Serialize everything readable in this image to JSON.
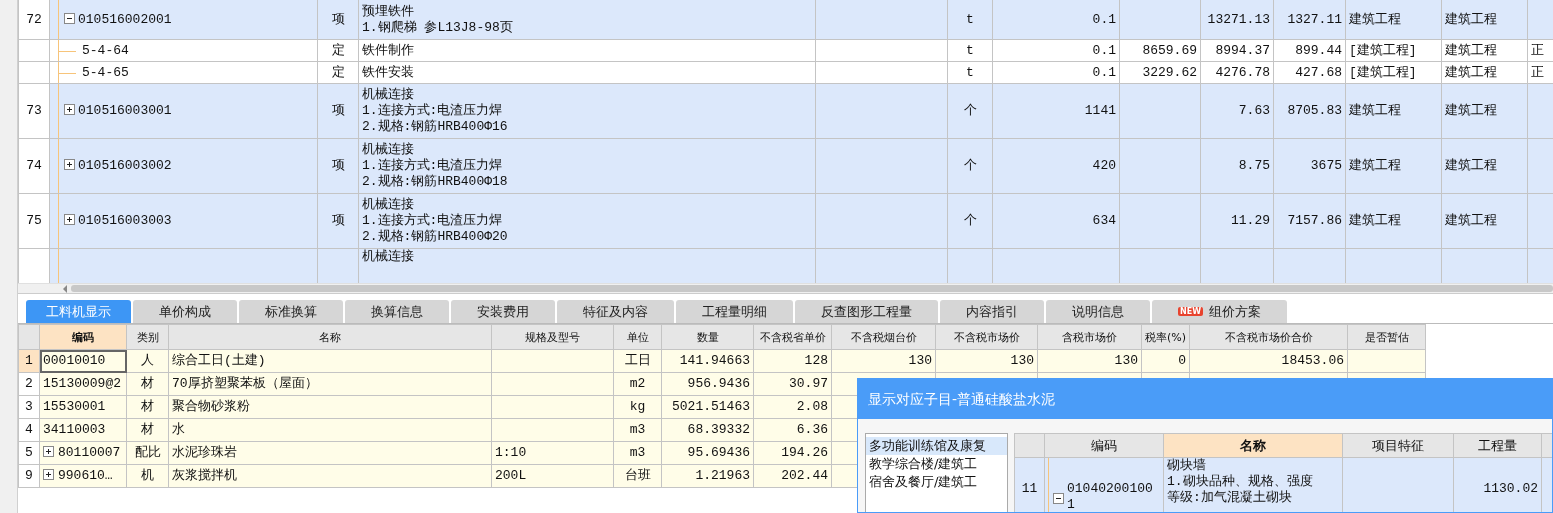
{
  "top_table": {
    "rows": [
      {
        "kind": "item",
        "column_1": "72",
        "expanded": true,
        "column_2": "010516002001",
        "column_3": "项",
        "column_4": [
          "预埋铁件",
          "1.钢爬梯 参L13J8-98页"
        ],
        "column_6": "t",
        "column_7": "0.1",
        "column_9": "13271.13",
        "column_10": "1327.11",
        "column_11": "建筑工程",
        "column_12": "建筑工程"
      },
      {
        "kind": "sub",
        "column_2": "5-4-64",
        "column_3": "定",
        "column_4": [
          "铁件制作"
        ],
        "column_6": "t",
        "column_7": "0.1",
        "column_8": "8659.69",
        "column_9": "8994.37",
        "column_10": "899.44",
        "column_11": "[建筑工程]",
        "column_12": "建筑工程",
        "column_13": "正"
      },
      {
        "kind": "sub",
        "column_2": "5-4-65",
        "column_3": "定",
        "column_4": [
          "铁件安装"
        ],
        "column_6": "t",
        "column_7": "0.1",
        "column_8": "3229.62",
        "column_9": "4276.78",
        "column_10": "427.68",
        "column_11": "[建筑工程]",
        "column_12": "建筑工程",
        "column_13": "正"
      },
      {
        "kind": "item",
        "column_1": "73",
        "expanded": false,
        "column_2": "010516003001",
        "column_3": "项",
        "column_4": [
          "机械连接",
          "1.连接方式:电渣压力焊",
          "2.规格:钢筋HRB400Φ16"
        ],
        "column_6": "个",
        "column_7": "1141",
        "column_9": "7.63",
        "column_10": "8705.83",
        "column_11": "建筑工程",
        "column_12": "建筑工程"
      },
      {
        "kind": "item",
        "column_1": "74",
        "expanded": false,
        "column_2": "010516003002",
        "column_3": "项",
        "column_4": [
          "机械连接",
          "1.连接方式:电渣压力焊",
          "2.规格:钢筋HRB400Φ18"
        ],
        "column_6": "个",
        "column_7": "420",
        "column_9": "8.75",
        "column_10": "3675",
        "column_11": "建筑工程",
        "column_12": "建筑工程"
      },
      {
        "kind": "item",
        "column_1": "75",
        "expanded": false,
        "column_2": "010516003003",
        "column_3": "项",
        "column_4": [
          "机械连接",
          "1.连接方式:电渣压力焊",
          "2.规格:钢筋HRB400Φ20"
        ],
        "column_6": "个",
        "column_7": "634",
        "column_9": "11.29",
        "column_10": "7157.86",
        "column_11": "建筑工程",
        "column_12": "建筑工程"
      },
      {
        "kind": "item",
        "column_4": [
          "机械连接"
        ]
      }
    ]
  },
  "tabs": [
    {
      "label": "工料机显示",
      "selected": true
    },
    {
      "label": "单价构成",
      "selected": false
    },
    {
      "label": "标准换算",
      "selected": false
    },
    {
      "label": "换算信息",
      "selected": false
    },
    {
      "label": "安装费用",
      "selected": false
    },
    {
      "label": "特征及内容",
      "selected": false
    },
    {
      "label": "工程量明细",
      "selected": false
    },
    {
      "label": "反查图形工程量",
      "selected": false
    },
    {
      "label": "内容指引",
      "selected": false
    },
    {
      "label": "说明信息",
      "selected": false
    },
    {
      "label": "组价方案",
      "selected": false,
      "badge": "NEW"
    }
  ],
  "resource_table": {
    "columns": [
      {
        "label": "编码",
        "sorted": true
      },
      {
        "label": "类别",
        "sorted": false
      },
      {
        "label": "名称",
        "sorted": false
      },
      {
        "label": "规格及型号",
        "sorted": false
      },
      {
        "label": "单位",
        "sorted": false
      },
      {
        "label": "数量",
        "sorted": false
      },
      {
        "label": "不含税省单价",
        "sorted": false
      },
      {
        "label": "不含税烟台价",
        "sorted": false
      },
      {
        "label": "不含税市场价",
        "sorted": false
      },
      {
        "label": "含税市场价",
        "sorted": false
      },
      {
        "label": "税率(%)",
        "sorted": false
      },
      {
        "label": "不含税市场价合价",
        "sorted": false
      },
      {
        "label": "是否暂估",
        "sorted": false
      }
    ],
    "rows": [
      {
        "num": "1",
        "selected": true,
        "code": "00010010",
        "category": "人",
        "name": "综合工日(土建)",
        "unit": "工日",
        "quantity": "141.94663",
        "province_price": "128",
        "yantai_price": "130",
        "market_price": "130",
        "market_price_tax": "130",
        "tax_rate": "0",
        "total": "18453.06"
      },
      {
        "num": "2",
        "selected": false,
        "code": "15130009@2",
        "category": "材",
        "name": "70厚挤塑聚苯板（屋面）",
        "unit": "m2",
        "quantity": "956.9436",
        "province_price": "30.97"
      },
      {
        "num": "3",
        "selected": false,
        "code": "15530001",
        "category": "材",
        "name": "聚合物砂浆粉",
        "unit": "kg",
        "quantity": "5021.51463",
        "province_price": "2.08"
      },
      {
        "num": "4",
        "selected": false,
        "code": "34110003",
        "category": "材",
        "name": "水",
        "unit": "m3",
        "quantity": "68.39332",
        "province_price": "6.36"
      },
      {
        "num": "5",
        "selected": false,
        "expanded": false,
        "code": "80110007",
        "category": "配比",
        "name": "水泥珍珠岩",
        "spec": "1:10",
        "unit": "m3",
        "quantity": "95.69436",
        "province_price": "194.26"
      },
      {
        "num": "9",
        "selected": false,
        "expanded": false,
        "code": "990610…",
        "category": "机",
        "name": "灰浆搅拌机",
        "spec": "200L",
        "unit": "台班",
        "quantity": "1.21963",
        "province_price": "202.44"
      }
    ]
  },
  "dialog": {
    "title": "显示对应子目-普通硅酸盐水泥",
    "projects": [
      {
        "label": "多功能训练馆及康复",
        "selected": true
      },
      {
        "label": "教学综合楼/建筑工",
        "selected": false
      },
      {
        "label": "宿舍及餐厅/建筑工",
        "selected": false
      }
    ],
    "columns": [
      {
        "label": "编码",
        "sorted": false
      },
      {
        "label": "名称",
        "sorted": true
      },
      {
        "label": "项目特征",
        "sorted": false
      },
      {
        "label": "工程量",
        "sorted": false
      }
    ],
    "rows": [
      {
        "num": "11",
        "expanded": true,
        "code": "010402001001",
        "name": [
          "砌块墙",
          "1.砌块品种、规格、强度",
          "等级:加气混凝土砌块"
        ],
        "quantity": "1130.02"
      }
    ]
  }
}
